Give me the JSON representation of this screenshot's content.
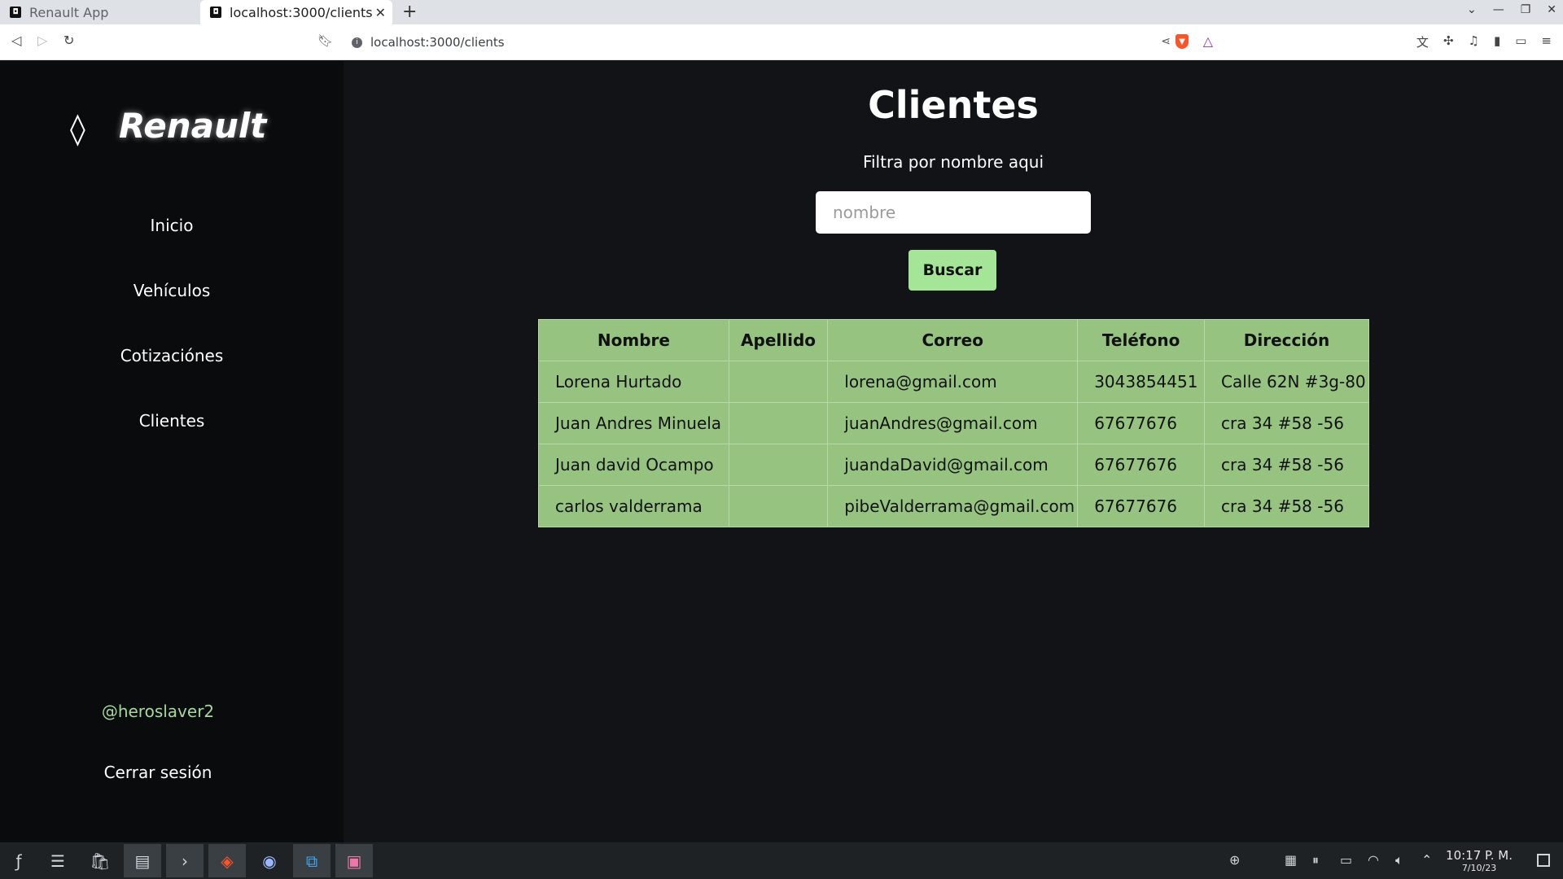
{
  "browser": {
    "tabs": [
      {
        "label": "Renault App"
      },
      {
        "label": "localhost:3000/clients"
      }
    ],
    "url": "localhost:3000/clients"
  },
  "sidebar": {
    "logo_text": "Renault",
    "nav": [
      {
        "label": "Inicio"
      },
      {
        "label": "Vehículos"
      },
      {
        "label": "Cotizaciónes"
      },
      {
        "label": "Clientes"
      }
    ],
    "username": "@heroslaver2",
    "logout_label": "Cerrar sesión"
  },
  "main": {
    "title": "Clientes",
    "filter_label": "Filtra por nombre aqui",
    "search": {
      "placeholder": "nombre",
      "value": ""
    },
    "search_button": "Buscar",
    "table": {
      "headers": [
        "Nombre",
        "Apellido",
        "Correo",
        "Teléfono",
        "Dirección"
      ],
      "rows": [
        [
          "Lorena Hurtado",
          "",
          "lorena@gmail.com",
          "3043854451",
          "Calle 62N #3g-80"
        ],
        [
          "Juan Andres Minuela",
          "",
          "juanAndres@gmail.com",
          "67677676",
          "cra 34 #58 -56"
        ],
        [
          "Juan david Ocampo",
          "",
          "juandaDavid@gmail.com",
          "67677676",
          "cra 34 #58 -56"
        ],
        [
          "carlos valderrama",
          "",
          "pibeValderrama@gmail.com",
          "67677676",
          "cra 34 #58 -56"
        ]
      ]
    }
  },
  "taskbar": {
    "time": "10:17 P. M.",
    "date": "7/10/23"
  },
  "colors": {
    "sidebar_bg": "#0a0b0d",
    "main_bg": "#111316",
    "table_bg": "#96c480",
    "button_bg": "#a4e597",
    "username_color": "#a4d99b"
  }
}
